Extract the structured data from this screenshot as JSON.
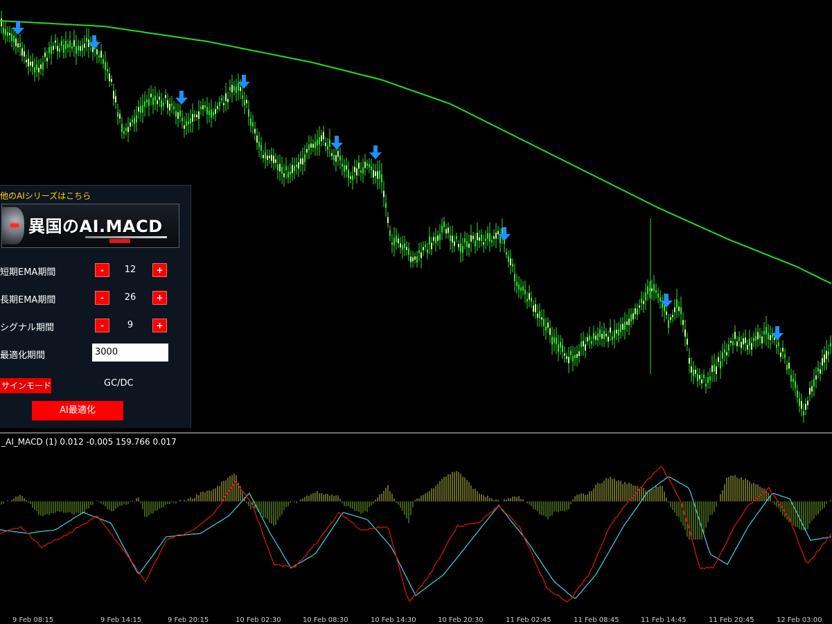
{
  "panel": {
    "title": "他のAIシリーズはこちら",
    "logo_text": "異国のAI.MACD",
    "rows": [
      {
        "label": "短期EMA期間",
        "minus": "-",
        "value": "12",
        "plus": "+"
      },
      {
        "label": "長期EMA期間",
        "minus": "-",
        "value": "26",
        "plus": "+"
      },
      {
        "label": "シグナル期間",
        "minus": "-",
        "value": "9",
        "plus": "+"
      }
    ],
    "optimize_period_label": "最適化期間",
    "optimize_period_value": "3000",
    "mode_button": "サインモード",
    "mode_value": "GC/DC",
    "optimize_button": "AI最適化"
  },
  "indicator": {
    "label": "_AI_MACD (1) 0.012 -0.005 159.766 0.017"
  },
  "time_axis": [
    "9 Feb 08:15",
    "9 Feb 14:15",
    "9 Feb 20:15",
    "10 Feb 02:30",
    "10 Feb 08:30",
    "10 Feb 14:30",
    "10 Feb 20:30",
    "11 Feb 02:45",
    "11 Feb 08:45",
    "11 Feb 14:45",
    "11 Feb 20:45",
    "12 Feb 03:00"
  ],
  "colors": {
    "candles": "#2ee52e",
    "candle_highlight": "#c8ff9a",
    "moving_average": "#22dd22",
    "signal_arrow": "#1e90ff",
    "hist_positive": "#c8c84a",
    "hist_negative": "#7fb52a",
    "macd_line": "#d41414",
    "signal_line": "#3ec8d8",
    "button_red": "#ff0000",
    "panel_bg": "#0d1521"
  },
  "icons": {
    "signal": "down-arrow-icon"
  }
}
